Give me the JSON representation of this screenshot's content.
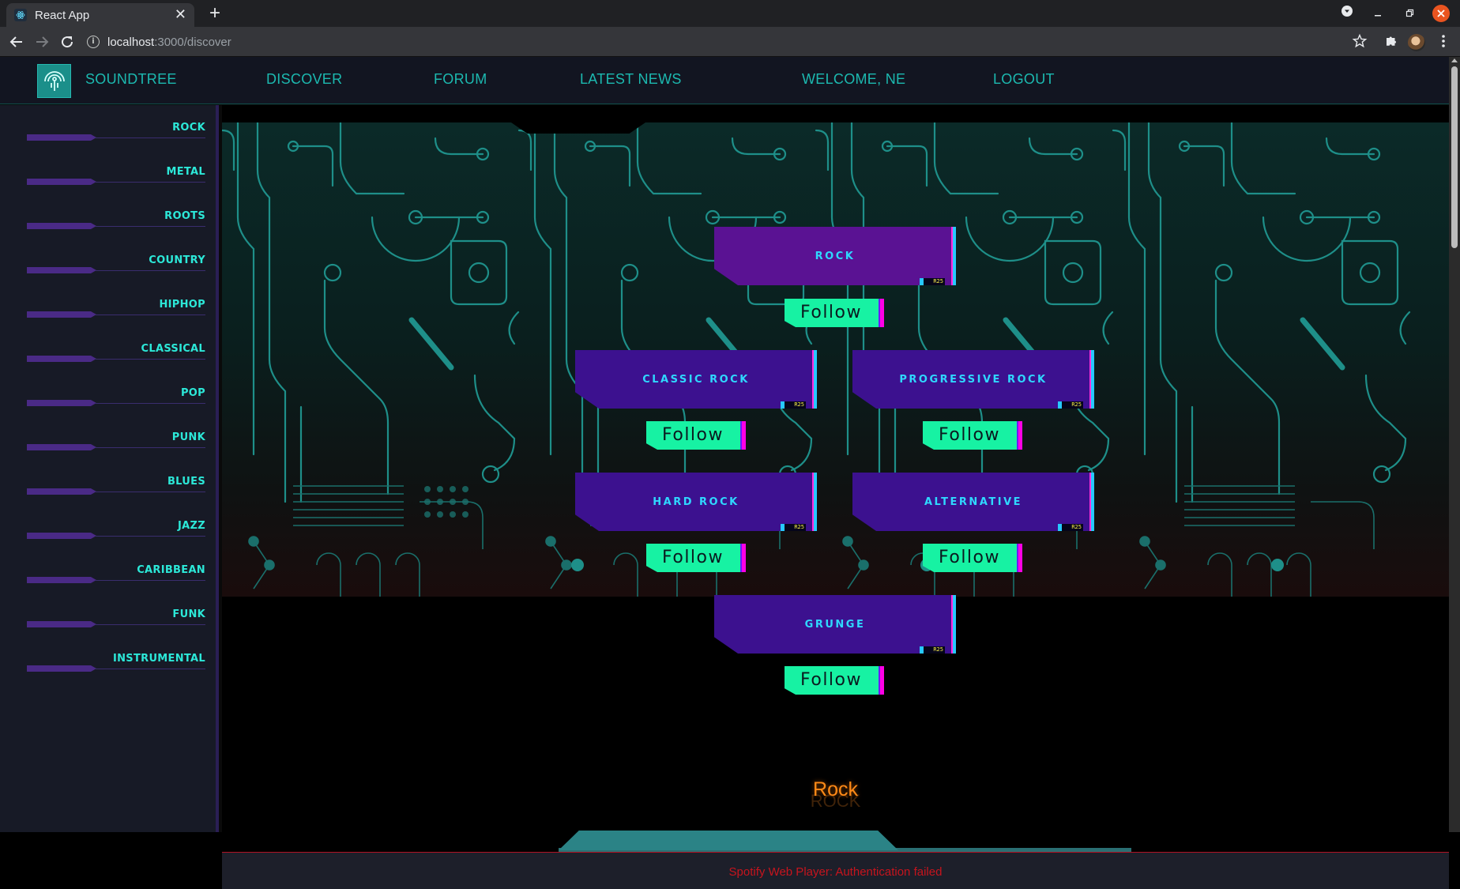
{
  "browser": {
    "tab_title": "React App",
    "url_host": "localhost",
    "url_path": ":3000/discover",
    "tab_close": "✕",
    "new_tab": "+"
  },
  "header": {
    "brand": "SOUNDTREE",
    "nav": [
      "DISCOVER",
      "FORUM",
      "LATEST NEWS",
      "WELCOME, NE",
      "LOGOUT"
    ]
  },
  "sidebar": {
    "items": [
      "ROCK",
      "METAL",
      "ROOTS",
      "COUNTRY",
      "HIPHOP",
      "CLASSICAL",
      "POP",
      "PUNK",
      "BLUES",
      "JAZZ",
      "CARIBBEAN",
      "FUNK",
      "INSTRUMENTAL"
    ]
  },
  "genre_tree": {
    "root": {
      "name": "ROCK",
      "tag": "R25",
      "follow": "Follow"
    },
    "children": [
      {
        "name": "CLASSIC ROCK",
        "tag": "R25",
        "follow": "Follow"
      },
      {
        "name": "PROGRESSIVE ROCK",
        "tag": "R25",
        "follow": "Follow"
      },
      {
        "name": "HARD ROCK",
        "tag": "R25",
        "follow": "Follow"
      },
      {
        "name": "ALTERNATIVE",
        "tag": "R25",
        "follow": "Follow"
      },
      {
        "name": "GRUNGE",
        "tag": "R25",
        "follow": "Follow"
      }
    ]
  },
  "now_playing": {
    "genre": "Rock",
    "genre_echo": "ROCK",
    "player_status": "Spotify Web Player: Authentication failed"
  },
  "colors": {
    "accent_teal": "#1cb9b0",
    "sidebar_label": "#2ce8d8",
    "genre_card": "#3c118f",
    "follow_button": "#17f2a3",
    "error_red": "#c7141d",
    "genre_title_orange": "#ff8a17"
  },
  "icons": {
    "tab_favicon": "react-logo-icon",
    "back": "arrow-left-icon",
    "forward": "arrow-right-icon",
    "reload": "reload-icon",
    "site_info": "info-icon",
    "bookmark": "star-icon",
    "extensions": "puzzle-icon",
    "menu": "kebab-menu-icon",
    "logo": "soundtree-logo-icon"
  }
}
